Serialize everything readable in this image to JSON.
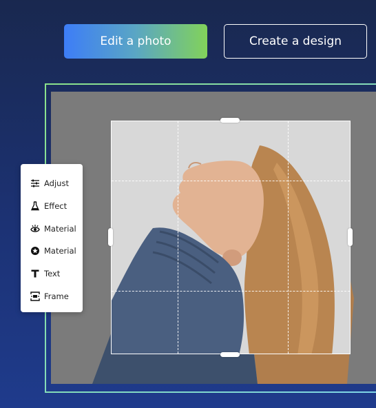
{
  "header": {
    "edit_photo_label": "Edit a photo",
    "create_design_label": "Create a design"
  },
  "toolbar": {
    "items": [
      {
        "label": "Adjust",
        "icon": "sliders-icon"
      },
      {
        "label": "Effect",
        "icon": "flask-icon"
      },
      {
        "label": "Material",
        "icon": "eye-icon"
      },
      {
        "label": "Material",
        "icon": "badge-icon"
      },
      {
        "label": "Text",
        "icon": "text-icon"
      },
      {
        "label": "Frame",
        "icon": "frame-icon"
      }
    ]
  },
  "colors": {
    "background_top": "#19284f",
    "background_bottom": "#1f3b8c",
    "button_gradient_start": "#3d7df7",
    "button_gradient_end": "#82d25a",
    "frame_border": "#7fe0c8"
  }
}
